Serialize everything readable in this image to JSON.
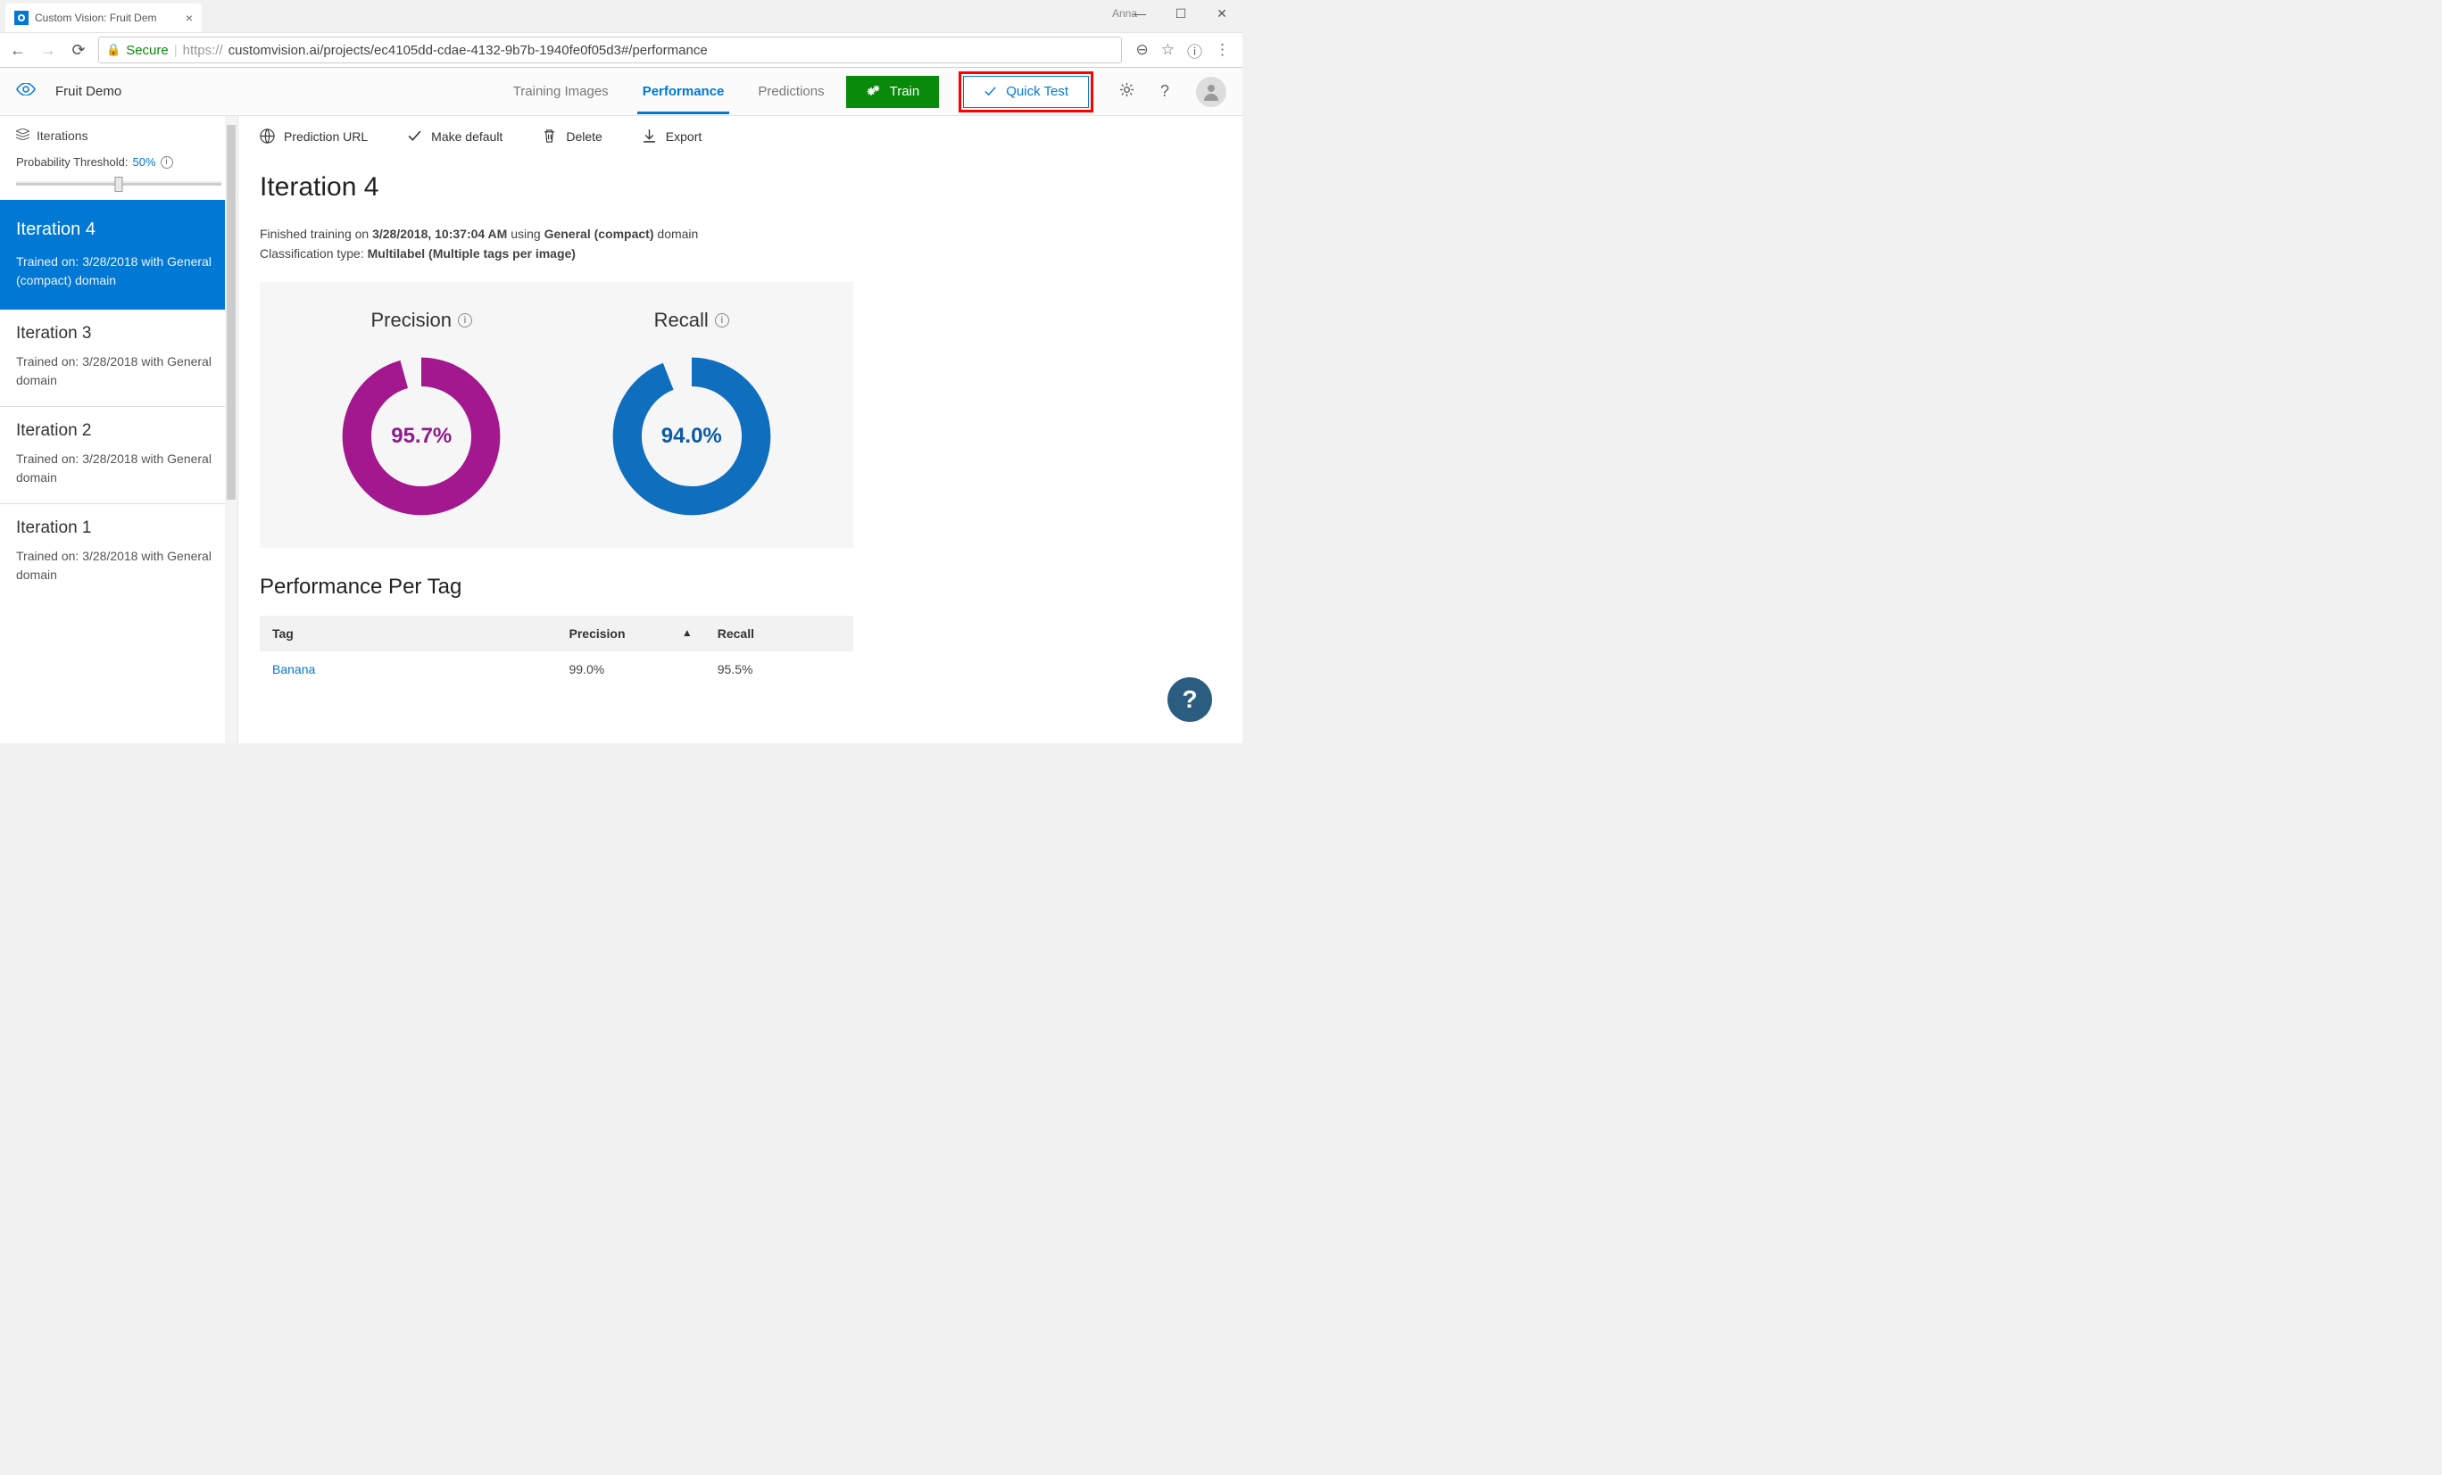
{
  "browser": {
    "tab_title": "Custom Vision: Fruit Dem",
    "user": "Anna",
    "secure_label": "Secure",
    "url_proto": "https://",
    "url_rest": "customvision.ai/projects/ec4105dd-cdae-4132-9b7b-1940fe0f05d3#/performance"
  },
  "header": {
    "project": "Fruit Demo",
    "tabs": {
      "training": "Training Images",
      "performance": "Performance",
      "predictions": "Predictions"
    },
    "train": "Train",
    "quick_test": "Quick Test"
  },
  "sidebar": {
    "iterations_label": "Iterations",
    "threshold_label": "Probability Threshold:",
    "threshold_value": "50%",
    "items": [
      {
        "title": "Iteration 4",
        "sub": "Trained on: 3/28/2018 with General (compact) domain"
      },
      {
        "title": "Iteration 3",
        "sub": "Trained on: 3/28/2018 with General domain"
      },
      {
        "title": "Iteration 2",
        "sub": "Trained on: 3/28/2018 with General domain"
      },
      {
        "title": "Iteration 1",
        "sub": "Trained on: 3/28/2018 with General domain"
      }
    ]
  },
  "toolbar": {
    "prediction_url": "Prediction URL",
    "make_default": "Make default",
    "delete": "Delete",
    "export": "Export"
  },
  "main": {
    "title": "Iteration 4",
    "meta_prefix": "Finished training on ",
    "meta_time": "3/28/2018, 10:37:04 AM",
    "meta_mid": " using ",
    "meta_domain": "General (compact)",
    "meta_domain_suffix": " domain",
    "class_prefix": "Classification type: ",
    "class_value": "Multilabel (Multiple tags per image)",
    "precision_label": "Precision",
    "recall_label": "Recall",
    "pp_tag": "Performance Per Tag",
    "th_tag": "Tag",
    "th_precision": "Precision",
    "th_recall": "Recall",
    "row_tag": "Banana",
    "row_precision": "99.0%",
    "row_recall": "95.5%"
  },
  "chart_data": [
    {
      "type": "pie",
      "title": "Precision",
      "value": 95.7,
      "display": "95.7%",
      "color": "#a3188f"
    },
    {
      "type": "pie",
      "title": "Recall",
      "value": 94.0,
      "display": "94.0%",
      "color": "#106ebe"
    }
  ]
}
